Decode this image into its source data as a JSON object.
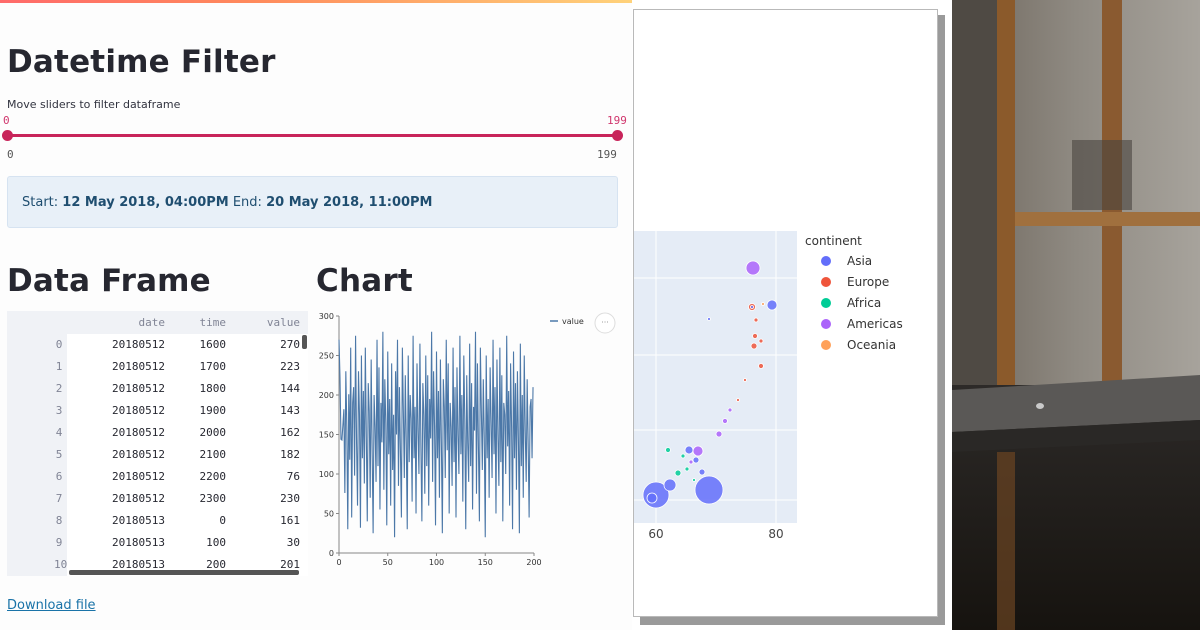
{
  "page": {
    "title": "Datetime Filter",
    "slider": {
      "label": "Move sliders to filter dataframe",
      "min_value": "0",
      "max_value": "199",
      "range_min_label": "0",
      "range_max_label": "199",
      "selected_fraction_low": 0,
      "selected_fraction_high": 1
    },
    "info": {
      "start_label": "Start:",
      "start_value": "12 May 2018, 04:00PM",
      "end_label": "End:",
      "end_value": "20 May 2018, 11:00PM"
    },
    "dataframe_title": "Data Frame",
    "chart_title": "Chart",
    "download_label": "Download file"
  },
  "dataframe": {
    "columns": [
      "date",
      "time",
      "value"
    ],
    "rows": [
      [
        "0",
        "20180512",
        "1600",
        "270"
      ],
      [
        "1",
        "20180512",
        "1700",
        "223"
      ],
      [
        "2",
        "20180512",
        "1800",
        "144"
      ],
      [
        "3",
        "20180512",
        "1900",
        "143"
      ],
      [
        "4",
        "20180512",
        "2000",
        "162"
      ],
      [
        "5",
        "20180512",
        "2100",
        "182"
      ],
      [
        "6",
        "20180512",
        "2200",
        "76"
      ],
      [
        "7",
        "20180512",
        "2300",
        "230"
      ],
      [
        "8",
        "20180513",
        "0",
        "161"
      ],
      [
        "9",
        "20180513",
        "100",
        "30"
      ],
      [
        "10",
        "20180513",
        "200",
        "201"
      ]
    ]
  },
  "colors": {
    "accent": "#c8245a",
    "line": "#4c78a8",
    "asia": "#636efa",
    "europe": "#ef553b",
    "africa": "#00cc96",
    "americas": "#ab63fa",
    "oceania": "#ffa15a"
  },
  "chart_data": [
    {
      "type": "line",
      "x_range": [
        0,
        199
      ],
      "ylim": [
        0,
        300
      ],
      "x_ticks": [
        "0",
        "50",
        "100",
        "150",
        "200"
      ],
      "y_ticks": [
        "0",
        "50",
        "100",
        "150",
        "200",
        "250",
        "300"
      ],
      "legend": "top-right",
      "series": [
        {
          "name": "value",
          "values": [
            270,
            223,
            144,
            143,
            162,
            182,
            76,
            230,
            161,
            30,
            201,
            118,
            260,
            45,
            190,
            210,
            98,
            275,
            140,
            60,
            230,
            175,
            32,
            250,
            120,
            205,
            88,
            260,
            150,
            40,
            215,
            180,
            70,
            245,
            130,
            25,
            200,
            160,
            90,
            270,
            110,
            235,
            55,
            190,
            140,
            280,
            80,
            220,
            165,
            35,
            255,
            125,
            195,
            60,
            240,
            105,
            175,
            20,
            230,
            150,
            270,
            85,
            210,
            130,
            45,
            260,
            180,
            95,
            225,
            140,
            30,
            250,
            115,
            200,
            170,
            65,
            275,
            120,
            185,
            50,
            240,
            155,
            100,
            265,
            135,
            40,
            215,
            175,
            75,
            250,
            110,
            225,
            60,
            195,
            145,
            280,
            90,
            230,
            160,
            35,
            255,
            120,
            205,
            70,
            245,
            140,
            25,
            220,
            185,
            95,
            270,
            130,
            240,
            50,
            190,
            160,
            85,
            260,
            115,
            210,
            45,
            235,
            150,
            100,
            275,
            125,
            200,
            65,
            250,
            170,
            30,
            225,
            140,
            90,
            265,
            110,
            215,
            55,
            185,
            155,
            280,
            75,
            240,
            135,
            40,
            260,
            180,
            105,
            220,
            145,
            20,
            250,
            120,
            195,
            70,
            235,
            165,
            95,
            270,
            125,
            210,
            50,
            245,
            150,
            85,
            260,
            115,
            225,
            40,
            190,
            175,
            100,
            275,
            135,
            205,
            60,
            240,
            160,
            30,
            255,
            120,
            215,
            80,
            230,
            145,
            25,
            265,
            110,
            200,
            70,
            250,
            155,
            90,
            220,
            140,
            45,
            185,
            195,
            120,
            210
          ]
        }
      ]
    },
    {
      "type": "scatter",
      "x_ticks": [
        "60",
        "80"
      ],
      "legend_title": "continent",
      "legend": "top-right",
      "series": [
        {
          "name": "Asia",
          "points": [
            [
              60.1,
              0
            ],
            [
              69,
              0
            ],
            [
              79,
              0
            ],
            [
              65,
              0
            ],
            [
              71,
              0
            ]
          ]
        },
        {
          "name": "Europe",
          "points": [
            [
              75.5,
              0
            ],
            [
              77,
              0
            ],
            [
              76,
              0
            ],
            [
              78,
              0
            ],
            [
              74,
              0
            ]
          ]
        },
        {
          "name": "Africa",
          "points": [
            [
              62,
              0
            ],
            [
              64,
              0
            ],
            [
              66,
              0
            ]
          ]
        },
        {
          "name": "Americas",
          "points": [
            [
              76,
              0
            ],
            [
              67,
              0
            ],
            [
              71,
              0
            ],
            [
              73,
              0
            ]
          ]
        },
        {
          "name": "Oceania",
          "points": [
            [
              80,
              0
            ]
          ]
        }
      ]
    }
  ]
}
